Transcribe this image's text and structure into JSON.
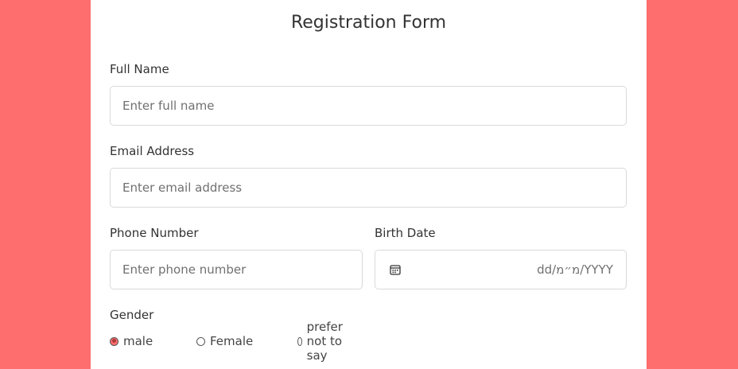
{
  "form": {
    "title": "Registration Form",
    "full_name": {
      "label": "Full Name",
      "placeholder": "Enter full name",
      "value": ""
    },
    "email": {
      "label": "Email Address",
      "placeholder": "Enter email address",
      "value": ""
    },
    "phone": {
      "label": "Phone Number",
      "placeholder": "Enter phone number",
      "value": ""
    },
    "birth_date": {
      "label": "Birth Date",
      "placeholder": "dd/מ״מ/YYYY",
      "icon": "calendar-icon"
    },
    "gender": {
      "label": "Gender",
      "options": [
        {
          "label": "male",
          "selected": true
        },
        {
          "label": "Female",
          "selected": false
        },
        {
          "label": "prefer not to say",
          "selected": false
        }
      ]
    }
  },
  "colors": {
    "background": "#ff6e6e",
    "card": "#ffffff",
    "border": "#d9d9d9",
    "text": "#333333",
    "placeholder": "#707070"
  }
}
